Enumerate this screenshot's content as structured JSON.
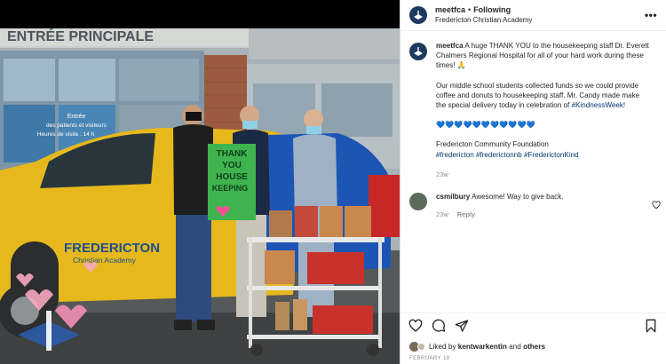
{
  "post_header": {
    "username": "meetfca",
    "separator": "•",
    "follow_state": "Following",
    "account_name": "Fredericton Christian Academy",
    "more_icon": "more-horizontal-icon"
  },
  "photo": {
    "sign_building": "ENTRÉE PRINCIPALE",
    "sign_door_line1": "Entrée",
    "sign_door_line2": "des patients et visiteurs",
    "sign_door_line3": "Heures de visite : 14 h",
    "poster_text": "THANK YOU HOUSE KEEPING",
    "car_brand": "FREDERICTON",
    "car_sub": "Christian Academy"
  },
  "caption": {
    "username": "meetfca",
    "para1": "A huge THANK YOU to the housekeeping staff Dr. Everett Chalmers Regional Hospital for all of your hard work during these times! 🙏",
    "para2_text": "Our middle school students collected funds so we could provide coffee and donuts to housekeeping staff. Mr. Candy made make the special delivery today in celebration of ",
    "para2_tag": "#KindnessWeek!",
    "hearts": "💙💙💙💙💙💙💙💙💙💙💙",
    "foundation": "Fredericton Community Foundation",
    "tags": "#fredericton #frederictonnb #FrederictonKind",
    "time": "23w"
  },
  "reply": {
    "username": "csmilbury",
    "text": "Awesome! Way to give back.",
    "time": "23w",
    "reply_label": "Reply"
  },
  "likes": {
    "prefix": "Liked by",
    "user": "kentwarkentin",
    "and": "and",
    "others": "others"
  },
  "date": "FEBRUARY 18"
}
